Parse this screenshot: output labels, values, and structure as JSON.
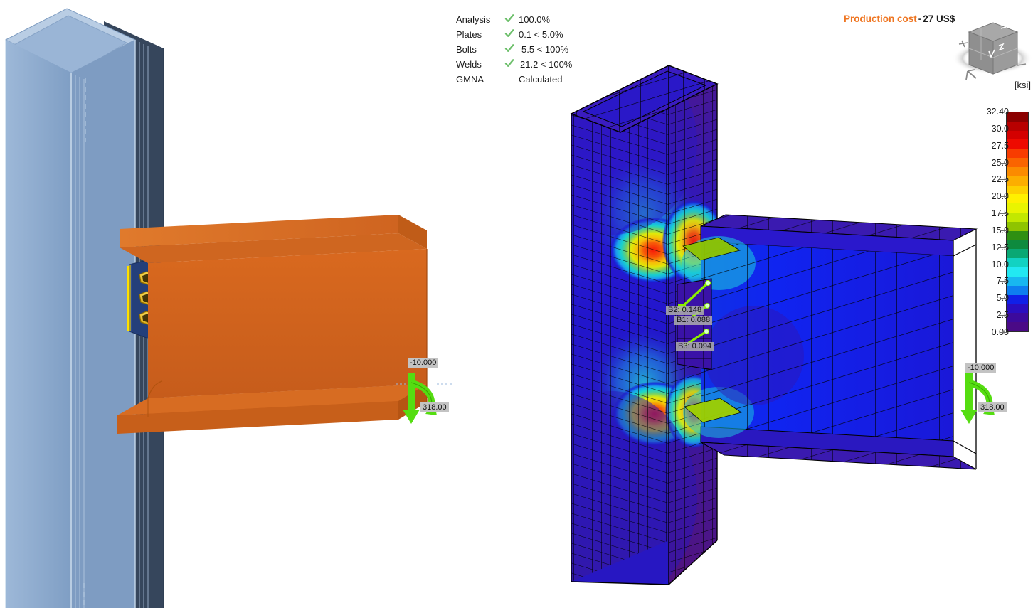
{
  "results": {
    "rows": [
      {
        "label": "Analysis",
        "check": "check-icon",
        "value": "100.0%"
      },
      {
        "label": "Plates",
        "check": "check-icon",
        "value": "0.1 < 5.0%"
      },
      {
        "label": "Bolts",
        "check": "check-icon",
        "value": "5.5 < 100%"
      },
      {
        "label": "Welds",
        "check": "check-icon",
        "value": "21.2 < 100%"
      },
      {
        "label": "GMNA",
        "check": "",
        "value": "Calculated"
      }
    ]
  },
  "production_cost": {
    "label": "Production cost",
    "separator": "-",
    "value": "27 US$",
    "label_color": "#ef7622"
  },
  "legend": {
    "unit": "[ksi]",
    "max_value": "32.40",
    "min_value": "0.00",
    "ticks": [
      "32.40",
      "30.0",
      "27.5",
      "25.0",
      "22.5",
      "20.0",
      "17.5",
      "15.0",
      "12.5",
      "10.0",
      "7.5",
      "5.0",
      "2.5",
      "0.00"
    ],
    "colors": [
      "#8b0000",
      "#b80000",
      "#d40000",
      "#ee0a00",
      "#f83c00",
      "#fa6400",
      "#fb8b00",
      "#fcae00",
      "#fdd000",
      "#fff000",
      "#e9f400",
      "#c2e800",
      "#8fc400",
      "#2f8f12",
      "#0e8a3e",
      "#0aa874",
      "#12d2c2",
      "#22e8f2",
      "#18b7f0",
      "#0e7ef0",
      "#1020e8",
      "#2a0ec0",
      "#3c0a9c",
      "#4a0a86"
    ]
  },
  "load_annotations": {
    "left": {
      "force": "-10.000",
      "moment": "318.00"
    },
    "right": {
      "force": "-10.000",
      "moment": "318.00"
    }
  },
  "bolt_labels": [
    {
      "id": "B2",
      "value": "B2: 0.148"
    },
    {
      "id": "B1",
      "value": "B1: 0.088"
    },
    {
      "id": "B3",
      "value": "B3: 0.094"
    }
  ],
  "model_colors": {
    "column": "#8aa9cc",
    "column_shadow": "#36465c",
    "beam": "#d4641f",
    "plate": "#243f7a",
    "bolt": "#e0b000",
    "weld": "#ffe000",
    "arrow": "#55dd11"
  },
  "view_cube": {
    "name": "view-cube",
    "face_top": "#a8a8a8",
    "face_left": "#8f8f8f",
    "face_right": "#9b9b9b"
  }
}
